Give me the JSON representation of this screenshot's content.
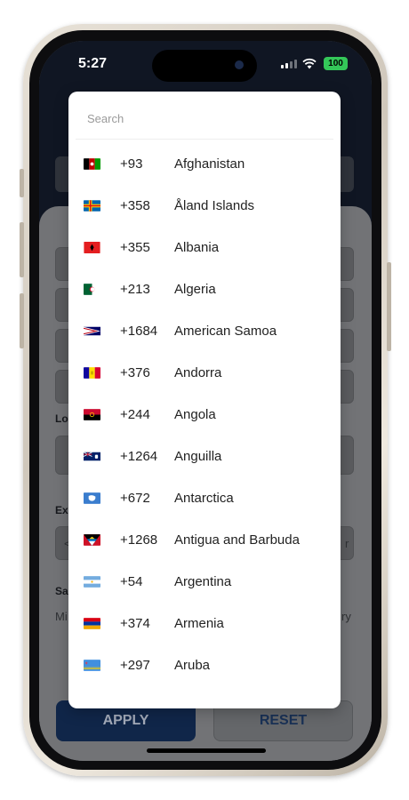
{
  "status_bar": {
    "time": "5:27",
    "battery": "100"
  },
  "background_form": {
    "labels": [
      "Lo",
      "Ex",
      "Sa"
    ],
    "field_fragments": [
      "<",
      "r"
    ],
    "help_text_left": "Mi",
    "help_text_right": "ry"
  },
  "search": {
    "placeholder": "Search"
  },
  "countries": [
    {
      "code": "+93",
      "name": "Afghanistan",
      "flag": "afghanistan-flag-icon"
    },
    {
      "code": "+358",
      "name": "Åland Islands",
      "flag": "aland-islands-flag-icon"
    },
    {
      "code": "+355",
      "name": "Albania",
      "flag": "albania-flag-icon"
    },
    {
      "code": "+213",
      "name": "Algeria",
      "flag": "algeria-flag-icon"
    },
    {
      "code": "+1684",
      "name": "American Samoa",
      "flag": "american-samoa-flag-icon"
    },
    {
      "code": "+376",
      "name": "Andorra",
      "flag": "andorra-flag-icon"
    },
    {
      "code": "+244",
      "name": "Angola",
      "flag": "angola-flag-icon"
    },
    {
      "code": "+1264",
      "name": "Anguilla",
      "flag": "anguilla-flag-icon"
    },
    {
      "code": "+672",
      "name": "Antarctica",
      "flag": "antarctica-flag-icon"
    },
    {
      "code": "+1268",
      "name": "Antigua and Barbuda",
      "flag": "antigua-barbuda-flag-icon"
    },
    {
      "code": "+54",
      "name": "Argentina",
      "flag": "argentina-flag-icon"
    },
    {
      "code": "+374",
      "name": "Armenia",
      "flag": "armenia-flag-icon"
    },
    {
      "code": "+297",
      "name": "Aruba",
      "flag": "aruba-flag-icon"
    }
  ],
  "buttons": {
    "apply": "APPLY",
    "reset": "RESET"
  },
  "colors": {
    "primary": "#142f59",
    "battery": "#34c759"
  }
}
